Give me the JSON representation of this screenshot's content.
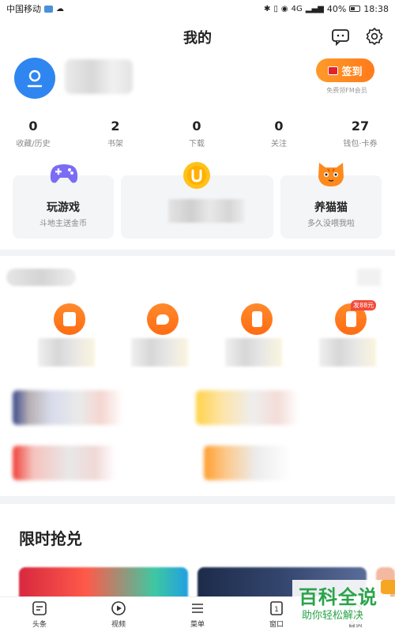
{
  "status_bar": {
    "carrier": "中国移动",
    "battery": "40%",
    "time": "18:38",
    "signal_text": "4G"
  },
  "header": {
    "title": "我的",
    "icons": [
      "message-icon",
      "gear-icon"
    ]
  },
  "profile": {
    "signin_label": "签到",
    "signin_note": "免费领FM会员"
  },
  "stats": [
    {
      "value": "0",
      "label": "收藏/历史"
    },
    {
      "value": "2",
      "label": "书架"
    },
    {
      "value": "0",
      "label": "下载"
    },
    {
      "value": "0",
      "label": "关注"
    },
    {
      "value": "27",
      "label": "钱包·卡券"
    }
  ],
  "cards": {
    "game": {
      "title": "玩游戏",
      "subtitle": "斗地主送金币"
    },
    "coin": {},
    "cat": {
      "title": "养猫猫",
      "subtitle": "多久没喂我啦"
    }
  },
  "services": {
    "badge": "发88元"
  },
  "flash_sale": {
    "title": "限时抢兑"
  },
  "bottom_nav": [
    {
      "label": "头条",
      "icon": "news-icon"
    },
    {
      "label": "视频",
      "icon": "play-icon"
    },
    {
      "label": "菜单",
      "icon": "menu-icon"
    },
    {
      "label": "窗口",
      "icon": "window-icon"
    },
    {
      "label": "首页",
      "icon": "home-icon"
    }
  ],
  "watermark": {
    "main": "百科全说",
    "sub": "助你轻松解决",
    "tag": "时"
  },
  "colors": {
    "accent_orange": "#ff7a1a",
    "avatar_blue": "#2f86f0",
    "watermark_green": "#2aa44a"
  }
}
